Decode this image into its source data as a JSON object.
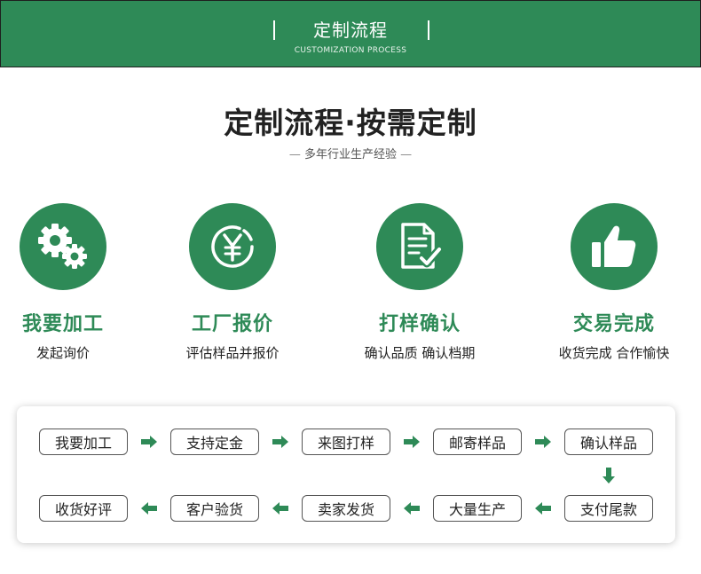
{
  "banner": {
    "title": "定制流程",
    "subtitle": "CUSTOMIZATION PROCESS",
    "background": "#2e8a57"
  },
  "heading": {
    "title": "定制流程·按需定制",
    "subtitle": "多年行业生产经验"
  },
  "accent_color": "#2e8a57",
  "steps": [
    {
      "icon": "gears-icon",
      "title": "我要加工",
      "desc": "发起询价"
    },
    {
      "icon": "yen-coin-icon",
      "title": "工厂报价",
      "desc": "评估样品并报价"
    },
    {
      "icon": "document-check-icon",
      "title": "打样确认",
      "desc": "确认品质 确认档期"
    },
    {
      "icon": "thumbs-up-icon",
      "title": "交易完成",
      "desc": "收货完成 合作愉快"
    }
  ],
  "flow": {
    "row1": [
      "我要加工",
      "支持定金",
      "来图打样",
      "邮寄样品",
      "确认样品"
    ],
    "row2": [
      "收货好评",
      "客户验货",
      "卖家发货",
      "大量生产",
      "支付尾款"
    ]
  }
}
